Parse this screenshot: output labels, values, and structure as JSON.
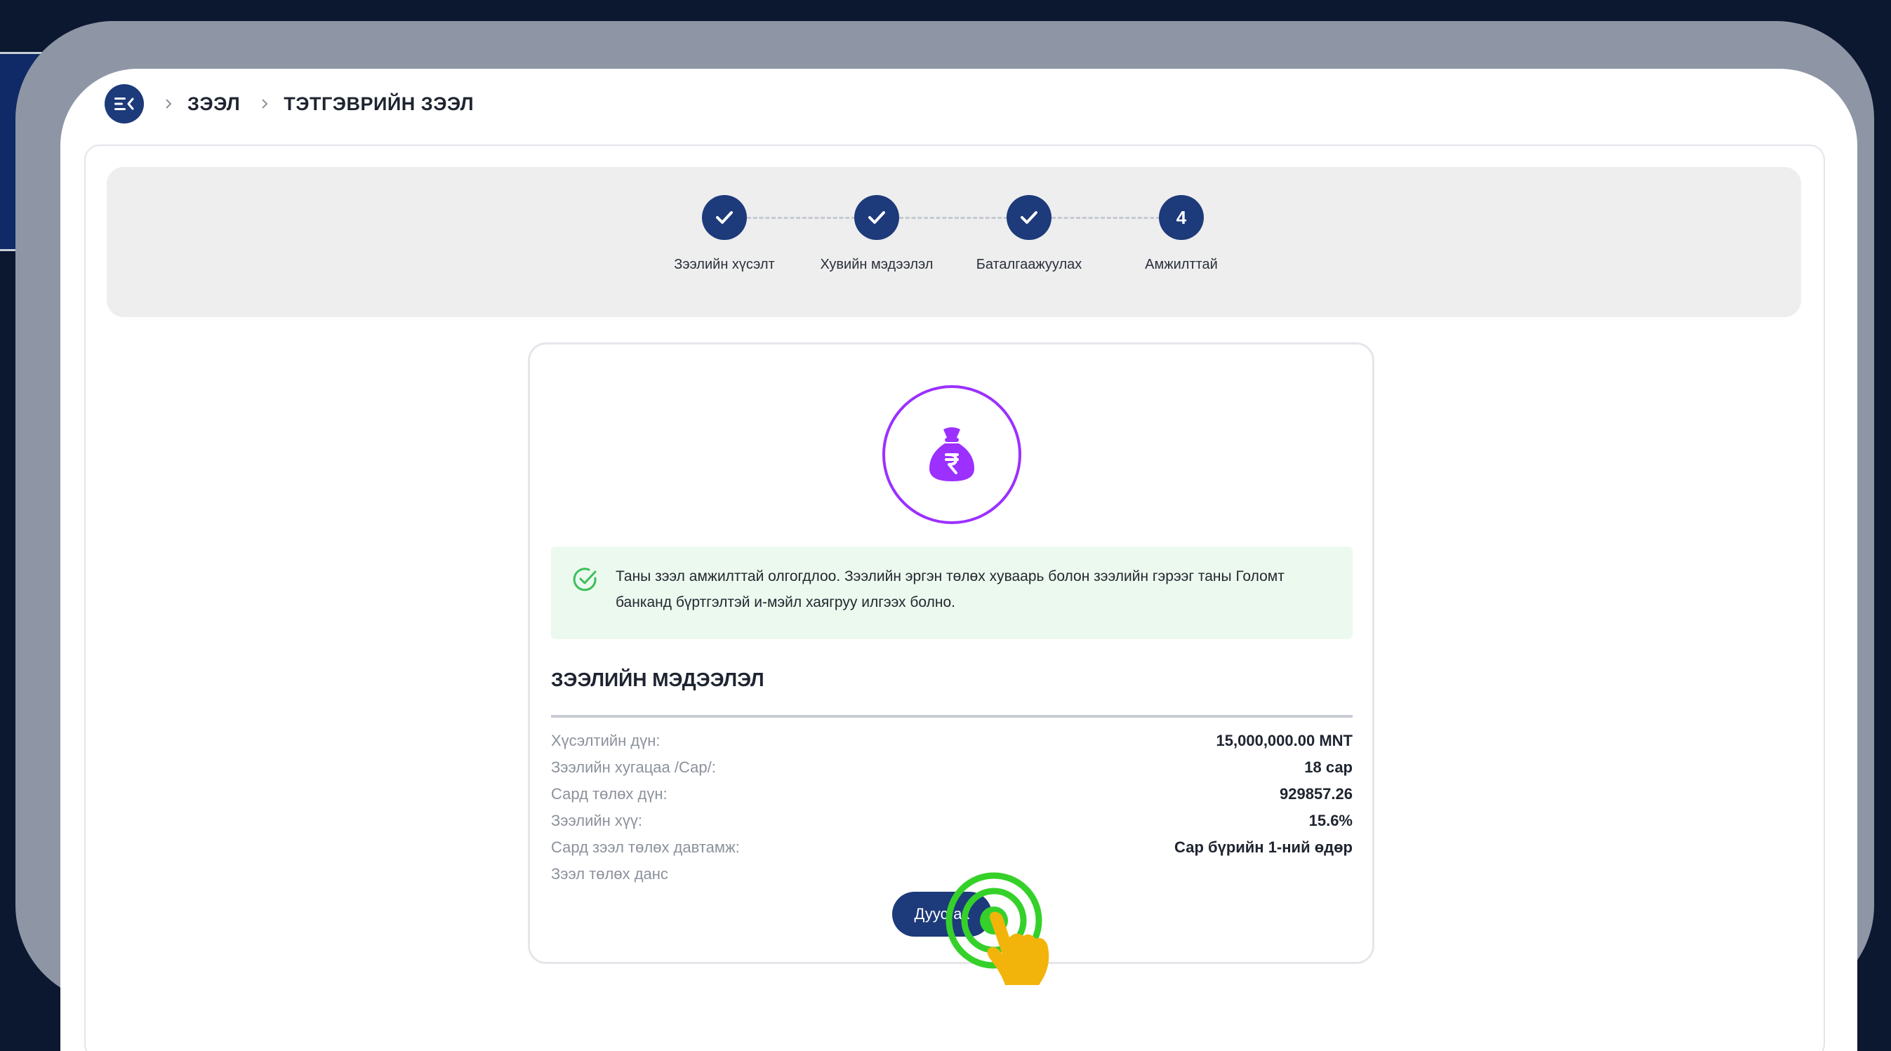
{
  "breadcrumb": {
    "menu_icon": "menu-collapse-icon",
    "items": [
      "ЗЭЭЛ",
      "ТЭТГЭВРИЙН ЗЭЭЛ"
    ]
  },
  "stepper": {
    "steps": [
      {
        "label": "Зээлийн хүсэлт",
        "state": "done",
        "marker": ""
      },
      {
        "label": "Хувийн мэдээлэл",
        "state": "done",
        "marker": ""
      },
      {
        "label": "Баталгаажуулах",
        "state": "done",
        "marker": ""
      },
      {
        "label": "Амжилттай",
        "state": "current",
        "marker": "4"
      }
    ]
  },
  "result": {
    "icon": "money-bag-icon",
    "success_message": "Таны зээл амжилттай олгогдлоо. Зээлийн эргэн төлөх хуваарь болон зээлийн гэрээг таны Голомт банканд бүртгэлтэй и-мэйл хаягруу илгээх болно.",
    "info_title": "ЗЭЭЛИЙН МЭДЭЭЛЭЛ",
    "rows": [
      {
        "label": "Хүсэлтийн дүн:",
        "value": "15,000,000.00 MNT"
      },
      {
        "label": "Зээлийн хугацаа /Сар/:",
        "value": "18 сар"
      },
      {
        "label": "Сард төлөх дүн:",
        "value": "929857.26"
      },
      {
        "label": "Зээлийн хүү:",
        "value": "15.6%"
      },
      {
        "label": "Сард зээл төлөх давтамж:",
        "value": "Сар бүрийн 1-ний өдөр"
      },
      {
        "label": "Зээл төлөх данс",
        "value": ""
      }
    ],
    "finish_button": "Дуусгах"
  },
  "colors": {
    "primary": "#1d3a7a",
    "accent_purple": "#9b30ff",
    "success_bg": "#ecf9ef",
    "success_icon": "#3bbf5a",
    "frame": "#8e96a5",
    "background": "#0b1830",
    "tap_green": "#35d12a",
    "tap_hand": "#f2b40b"
  }
}
